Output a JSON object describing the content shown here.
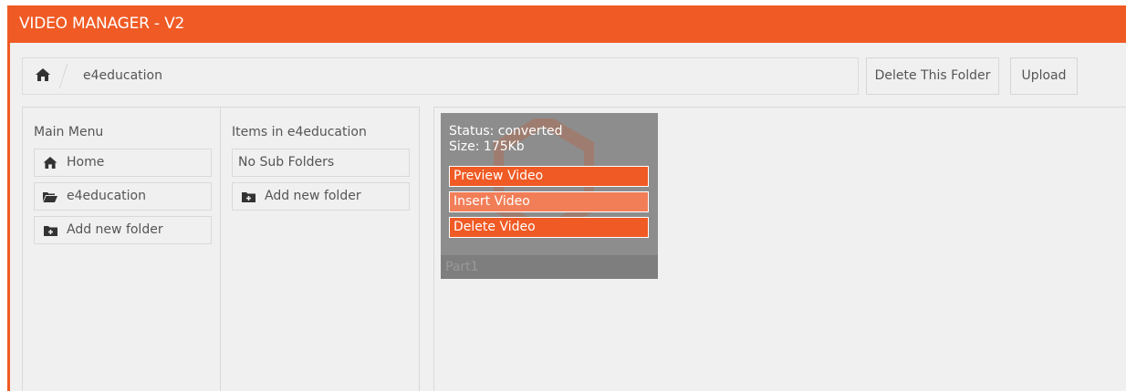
{
  "app": {
    "title": "VIDEO MANAGER - V2",
    "accent_color": "#f05a24"
  },
  "breadcrumb": {
    "home_icon": "home-icon",
    "current": "e4education"
  },
  "toolbar": {
    "delete_folder_label": "Delete This Folder",
    "upload_label": "Upload"
  },
  "main_menu": {
    "title": "Main Menu",
    "items": [
      {
        "icon": "home-icon",
        "label": "Home"
      },
      {
        "icon": "folder-open-icon",
        "label": "e4education"
      },
      {
        "icon": "folder-plus-icon",
        "label": "Add new folder"
      }
    ]
  },
  "folder_items": {
    "title": "Items in e4education",
    "empty_label": "No Sub Folders",
    "add_label": "Add new folder"
  },
  "video": {
    "status": "Status: converted",
    "size": "Size: 175Kb",
    "preview_label": "Preview Video",
    "insert_label": "Insert Video",
    "delete_label": "Delete Video",
    "name": "Part1"
  }
}
